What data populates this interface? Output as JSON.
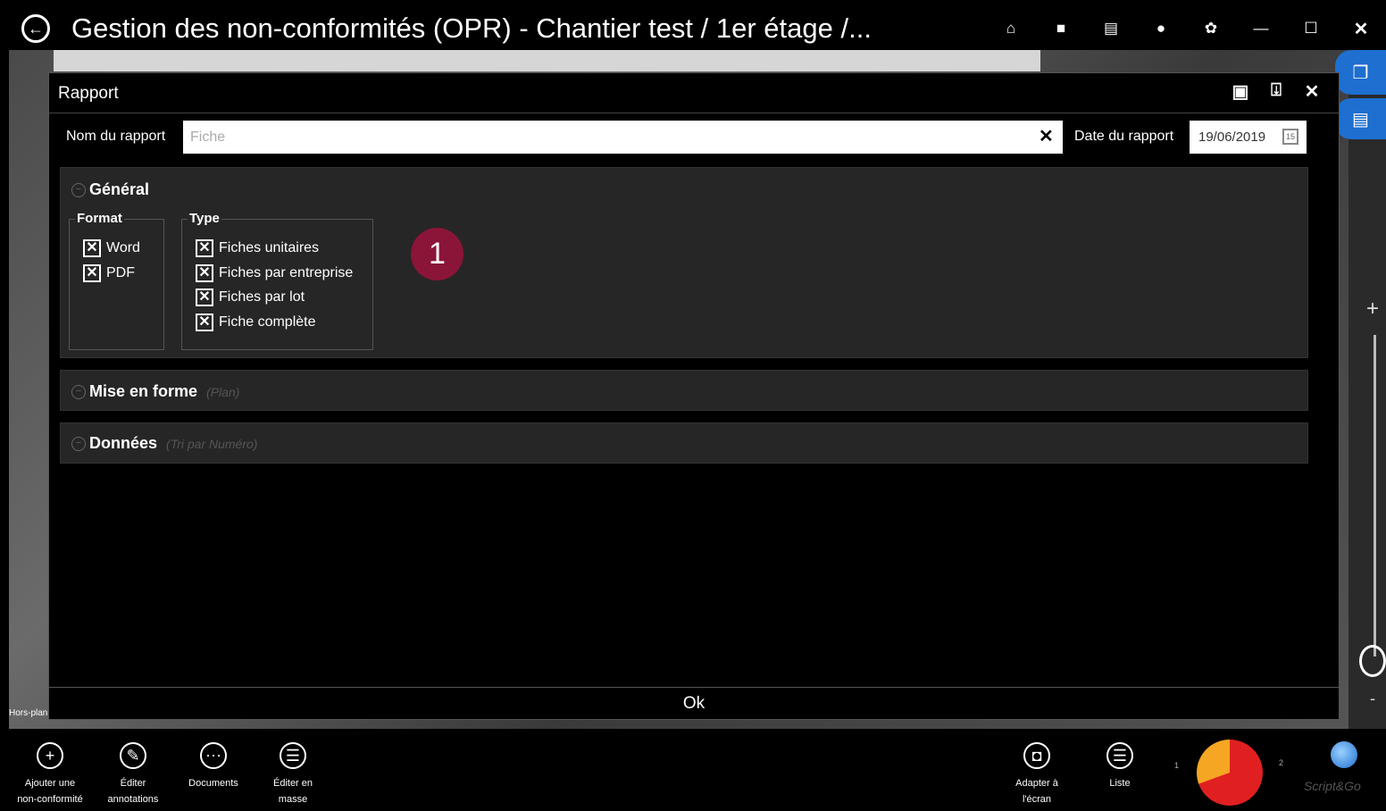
{
  "window": {
    "title": "Gestion des non-conformités (OPR) - Chantier test / 1er étage /...",
    "icons": [
      "home-icon",
      "folder-icon",
      "document-icon",
      "user-icon",
      "gear-icon",
      "minimize-icon",
      "maximize-icon",
      "close-icon"
    ]
  },
  "dialog": {
    "title": "Rapport",
    "report_name_label": "Nom du rapport",
    "report_name_placeholder": "Fiche",
    "report_date_label": "Date du rapport",
    "report_date_value": "19/06/2019",
    "ok_label": "Ok"
  },
  "sections": {
    "general": {
      "title": "Général",
      "format": {
        "legend": "Format",
        "options": [
          {
            "label": "Word",
            "checked": true
          },
          {
            "label": "PDF",
            "checked": true
          }
        ]
      },
      "type": {
        "legend": "Type",
        "options": [
          {
            "label": "Fiches unitaires",
            "checked": true
          },
          {
            "label": "Fiches par entreprise",
            "checked": true
          },
          {
            "label": "Fiches par lot",
            "checked": true
          },
          {
            "label": "Fiche complète",
            "checked": true
          }
        ]
      }
    },
    "mise_en_forme": {
      "title": "Mise en forme",
      "subtitle": "(Plan)"
    },
    "donnees": {
      "title": "Données",
      "subtitle": "(Tri par Numéro)"
    }
  },
  "callout": {
    "number": "1",
    "color": "#8a1538"
  },
  "side": {
    "hors_plan": "Hors-plan",
    "zoom_plus": "+",
    "zoom_minus": "-"
  },
  "bottombar": {
    "items": [
      {
        "label": "Ajouter une\nnon-conformité",
        "icon": "plus-circle-icon"
      },
      {
        "label": "Éditer\nannotations",
        "icon": "edit-icon"
      },
      {
        "label": "Documents",
        "icon": "more-icon"
      },
      {
        "label": "Éditer en\nmasse",
        "icon": "list-icon"
      },
      {
        "label": "Adapter à\nl'écran",
        "icon": "fit-screen-icon"
      },
      {
        "label": "Liste",
        "icon": "list-icon"
      }
    ],
    "pie_labels": [
      "1",
      "2"
    ],
    "brand": "Script&Go"
  },
  "colors": {
    "accent_blue": "#1e6fd0",
    "pie_red": "#e02020",
    "pie_orange": "#f5a623"
  }
}
